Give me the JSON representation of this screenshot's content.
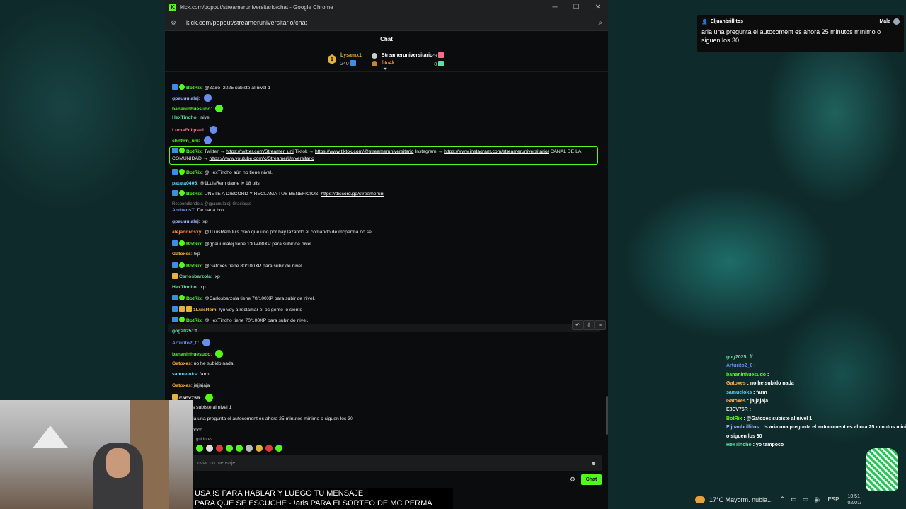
{
  "window": {
    "title": "kick.com/popout/streameruniversitario/chat - Google Chrome",
    "url": "kick.com/popout/streameruniversitario/chat"
  },
  "chat": {
    "header": "Chat",
    "leaderboard": {
      "rank": "1",
      "first": {
        "name": "bysamx1",
        "score": "240"
      },
      "second": {
        "name": "Streameruniversitario",
        "score": "29"
      },
      "third": {
        "name": "fito4k",
        "score": "8"
      }
    },
    "messages": [
      {
        "user": "BotRix",
        "color": "#53fc18",
        "text": "@Zairo_2025 subiste al nivel 1",
        "badges": [
          "blue",
          "green"
        ]
      },
      {
        "user": "gpauuulalej",
        "color": "#9fb6ff",
        "text": "",
        "emote": "#6a8cf0"
      },
      {
        "user": "bananinhuesudo",
        "color": "#53fc18",
        "text": "",
        "emote": "#53fc18"
      },
      {
        "user": "HexTincho",
        "color": "#5ae0a0",
        "text": "!nivel"
      },
      {
        "user": "LumaEclipse1",
        "color": "#ff6a8a",
        "text": "",
        "emote": "#6a8cf0"
      },
      {
        "user": "chntwn_uni",
        "color": "#53fc18",
        "text": "",
        "emote": "#6a8cf0"
      },
      {
        "user": "BotRix",
        "color": "#53fc18",
        "text": "@HexTincho aún no tiene nivel.",
        "badges": [
          "blue",
          "green"
        ]
      },
      {
        "user": "patata0405",
        "color": "#5ad7ff",
        "text": "@1LuisRem dame lv 18 plis"
      },
      {
        "user": "BotRix",
        "color": "#53fc18",
        "text": "UNETE A DISCORD Y RECLAMA TUS BENEFICIOS: ",
        "link": "https://discord.gg/streameruni",
        "badges": [
          "blue",
          "green"
        ]
      },
      {
        "reply": "Respondiendo a @gpauuulalej: Graciasss"
      },
      {
        "user": "AndreusT",
        "color": "#6a8cf0",
        "text": "De nada bro"
      },
      {
        "user": "gpauuulalej",
        "color": "#9fb6ff",
        "text": "!xp"
      },
      {
        "user": "alejandrosxy",
        "color": "#ff8a3a",
        "text": "@1LuisRem luis creo que uno por hay lazando el comando de mcperma no se"
      },
      {
        "user": "BotRix",
        "color": "#53fc18",
        "text": "@gpauuulalej tiene 130/400XP para subir de nivel.",
        "badges": [
          "blue",
          "green"
        ]
      },
      {
        "user": "Gatoxes",
        "color": "#ffb347",
        "text": "!xp"
      },
      {
        "user": "BotRix",
        "color": "#53fc18",
        "text": "@Gatoxes tiene 80/100XP para subir de nivel.",
        "badges": [
          "blue",
          "green"
        ]
      },
      {
        "user": "Carlosbarzola",
        "color": "#5ae0a0",
        "text": "!xp",
        "badges": [
          "gold"
        ]
      },
      {
        "user": "HexTincho",
        "color": "#5ae0a0",
        "text": "!xp"
      },
      {
        "user": "BotRix",
        "color": "#53fc18",
        "text": "@Carlosbarzola tiene 70/100XP para subir de nivel.",
        "badges": [
          "blue",
          "green"
        ]
      },
      {
        "user": "1LuisRem",
        "color": "#ffb347",
        "text": "!yo voy a reclamar el pc gente lo siento",
        "badges": [
          "blue",
          "gold",
          "gold"
        ]
      },
      {
        "user": "BotRix",
        "color": "#53fc18",
        "text": "@HexTincho tiene 70/100XP para subir de nivel.",
        "badges": [
          "blue",
          "green"
        ]
      },
      {
        "user": "gog2025",
        "color": "#5ae0a0",
        "text": "ff"
      },
      {
        "user": "Arturito2_0",
        "color": "#6a8cf0",
        "text": "",
        "emote": "#6a8cf0"
      },
      {
        "user": "bananinhuesudo",
        "color": "#53fc18",
        "text": "",
        "emote": "#53fc18"
      },
      {
        "user": "Gatoxes",
        "color": "#ffb347",
        "text": "no he subido nada"
      },
      {
        "user": "samueloks",
        "color": "#5ad7ff",
        "text": "farm"
      },
      {
        "user": "Gatoxes",
        "color": "#ffb347",
        "text": "jajjajaja"
      },
      {
        "user": "E8EV75R",
        "color": "#e0e0e0",
        "text": "",
        "emote": "#53fc18",
        "badges": [
          "gold"
        ]
      },
      {
        "user": "",
        "color": "#53fc18",
        "text": "@Gatoxes subiste al nivel 1"
      },
      {
        "user": "ltos",
        "color": "#e0e0e0",
        "text": "!s aria una pregunta el autocoment es ahora 25 minutos minimo o siguen los 30"
      },
      {
        "user": "o",
        "color": "#e0e0e0",
        "text": "yo tampoco"
      }
    ],
    "pinned": {
      "user": "BotRix",
      "pre": "Twitter → ",
      "link1": "https://twitter.com/Streamer_uni",
      "mid1": " Tiktok → ",
      "link2": "https://www.tiktok.com/@streameruniversitario",
      "mid2": " Instagram → ",
      "link3": "https://www.instagram.com/streameruniversitario/",
      "mid3": " CANAL DE LA",
      "line2pre": "COMUNIDAD → ",
      "link4": "https://www.youtube.com/c/StreamerUniversitario"
    },
    "followers_label": "guidores",
    "input_placeholder": "nviar un mensaje",
    "send_label": "Chat"
  },
  "subtitle": {
    "line1": "USA !S PARA HABLAR Y LUEGO TU MENSAJE",
    "line2": "PARA QUE SE ESCUCHE - !aris PARA ELSORTEO DE MC PERMA"
  },
  "alert": {
    "user": "Eljuanbrillitos",
    "voice": "Male",
    "text": "aria una pregunta el autocoment es ahora 25 minutos mínimo o siguen los 30"
  },
  "overlay_chat": [
    {
      "user": "gog2025",
      "color": "#5ae0a0",
      "text": ": ff"
    },
    {
      "user": "Arturito2_0",
      "color": "#6a8cf0",
      "text": " :"
    },
    {
      "user": "bananinhuesudo",
      "color": "#53fc18",
      "text": " :"
    },
    {
      "user": "Gatoxes",
      "color": "#ffb347",
      "text": " : no he subido nada"
    },
    {
      "user": "samueloks",
      "color": "#5ad7ff",
      "text": " : farm"
    },
    {
      "user": "Gatoxes",
      "color": "#ffb347",
      "text": " : jajjajaja"
    },
    {
      "user": "E8EV75R",
      "color": "#e0e0e0",
      "text": " :"
    },
    {
      "user": "BotRix",
      "color": "#53fc18",
      "text": " : @Gatoxes subiste al nivel 1"
    },
    {
      "user": "Eljuanbrillitos",
      "color": "#9fb6ff",
      "text": " : !s aria una pregunta el autocoment es ahora 25 minutos minimo"
    },
    {
      "user": "",
      "color": "#fff",
      "text": "o siguen los 30"
    },
    {
      "user": "HexTincho",
      "color": "#5ae0a0",
      "text": " : yo tampoco"
    }
  ],
  "taskbar": {
    "weather": "17°C  Mayorm. nubla...",
    "lang": "ESP",
    "time": "10:51",
    "date": "02/01/"
  }
}
